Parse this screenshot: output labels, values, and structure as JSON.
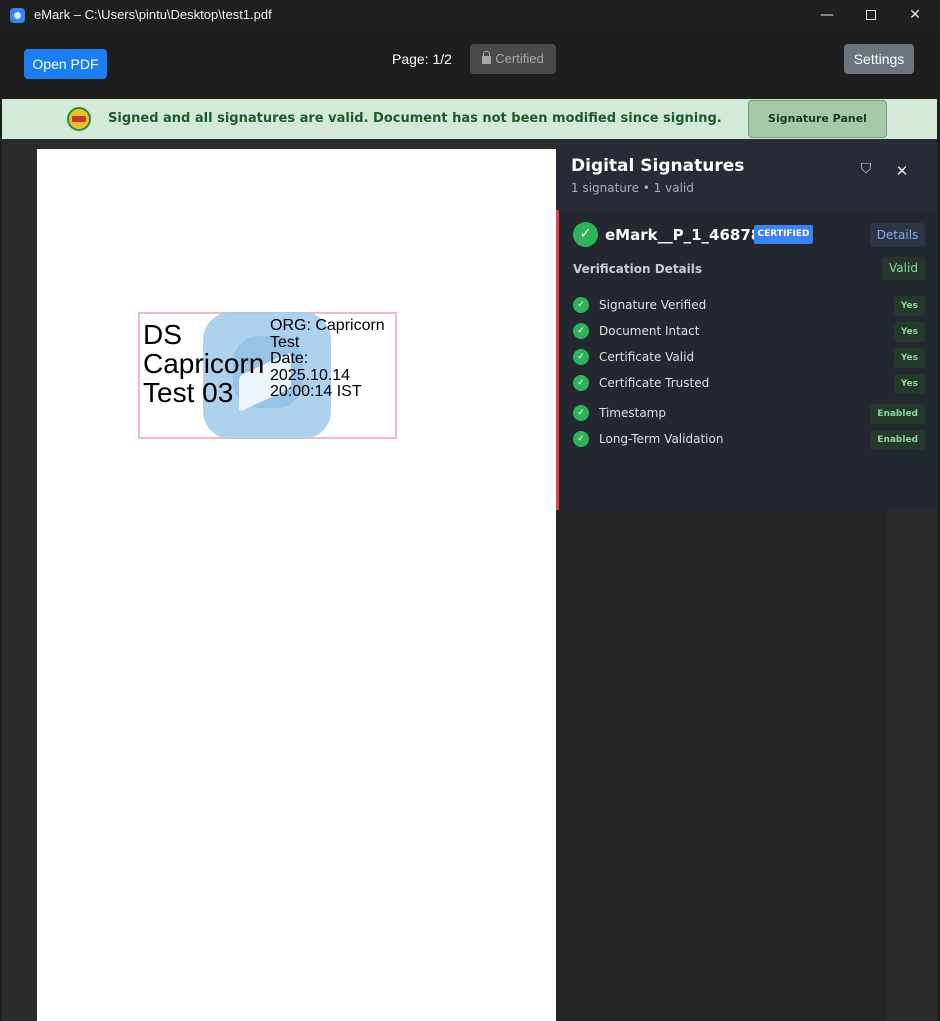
{
  "window": {
    "title": "eMark – C:\\Users\\pintu\\Desktop\\test1.pdf",
    "minimize": "—",
    "close": "✕"
  },
  "toolbar": {
    "open_label": "Open PDF",
    "page_label": "Page: 1/2",
    "certified_label": "Certified",
    "settings_label": "Settings"
  },
  "banner": {
    "badge_icon": "certified-seal-icon",
    "message": "Signed and all signatures are valid. Document has not been modified since signing.",
    "signature_panel_label": "Signature Panel"
  },
  "stamp": {
    "left_text": "DS Capricorn Test 03",
    "org": "ORG: Capricorn Test",
    "date_label": "Date:",
    "date_value": "2025.10.14 20:00:14 IST"
  },
  "panel": {
    "title": "Digital Signatures",
    "subtitle": "1 signature • 1 valid",
    "shield_icon": "⛉",
    "close_icon": "✕",
    "signature": {
      "name": "eMark__P_1_468782",
      "badge": "CERTIFIED",
      "details_label": "Details",
      "verification_label": "Verification Details",
      "status": "Valid",
      "checks": [
        {
          "label": "Signature Verified",
          "value": "Yes"
        },
        {
          "label": "Document Intact",
          "value": "Yes"
        },
        {
          "label": "Certificate Valid",
          "value": "Yes"
        },
        {
          "label": "Certificate Trusted",
          "value": "Yes"
        },
        {
          "label": "Timestamp",
          "value": "Enabled"
        },
        {
          "label": "Long-Term Validation",
          "value": "Enabled"
        }
      ]
    }
  },
  "colors": {
    "accent_blue": "#1a7ef2",
    "valid_green": "#2fb35a",
    "banner_bg": "#d4ead8",
    "card_border": "#e0434d"
  }
}
